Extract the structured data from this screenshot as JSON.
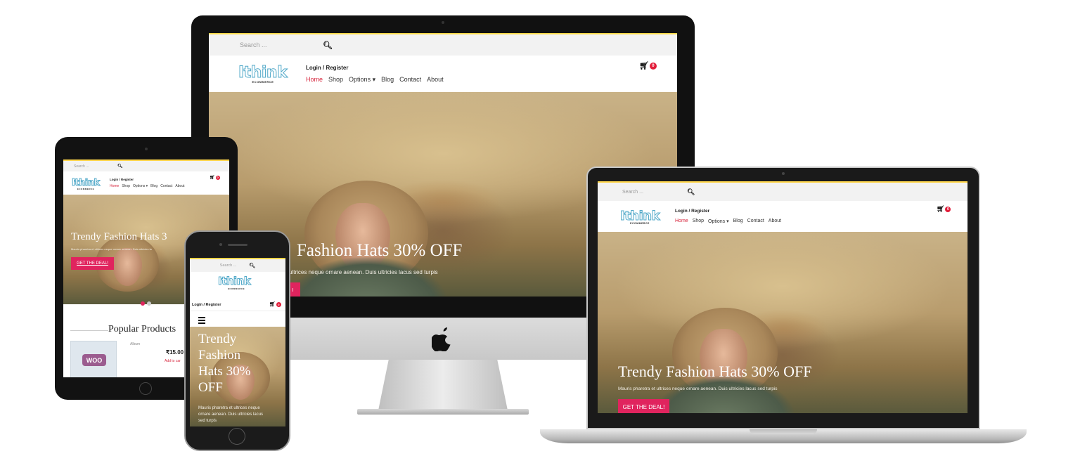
{
  "site": {
    "search_placeholder": "Search ...",
    "logo_text": "Ithink",
    "logo_sub": "ECOMMERCE",
    "login_register": "Login / Register",
    "nav": [
      {
        "label": "Home",
        "active": true
      },
      {
        "label": "Shop"
      },
      {
        "label": "Options ▾"
      },
      {
        "label": "Blog"
      },
      {
        "label": "Contact"
      },
      {
        "label": "About"
      }
    ],
    "cart_count": "0"
  },
  "imac_hero": {
    "title": "Fashion Hats 30% OFF",
    "desc": "ultrices neque ornare aenean. Duis ultricies lacus sed turpis",
    "cta": "I"
  },
  "laptop_hero": {
    "title": "Trendy Fashion Hats 30% OFF",
    "desc": "Mauris pharetra et ultrices neque ornare aenean. Duis ultricies lacus sed turpis",
    "cta": "GET THE DEAL!"
  },
  "tablet": {
    "title": "Trendy Fashion Hats 3",
    "desc": "Mauris pharetra et ultrices neque ornare aenean. Duis ultricies la",
    "cta": "GET THE DEAL!",
    "popular_heading": "Popular Products",
    "product_category": "Album",
    "product_price": "₹15.00",
    "add_to_cart": "Add to car",
    "thumb_label": "WOO"
  },
  "phone": {
    "title_lines": [
      "Trendy",
      "Fashion",
      "Hats 30%",
      "OFF"
    ],
    "desc_lines": [
      "Mauris pharetra et ultrices neque",
      "ornare aenean. Duis ultricies lacus",
      "sed turpis"
    ]
  },
  "colors": {
    "accent_red": "#d7263d",
    "cta_pink": "#e0245e",
    "top_border_yellow": "#ffd64a",
    "logo_blue": "#52a9c9"
  }
}
